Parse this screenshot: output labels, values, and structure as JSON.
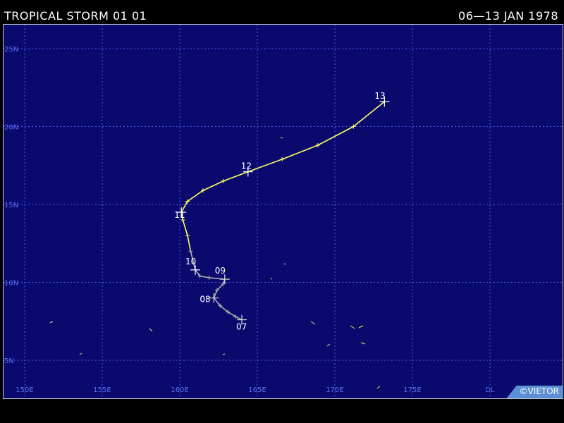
{
  "header": {
    "title": "TROPICAL STORM 01 01",
    "date_range": "06—13 JAN 1978"
  },
  "map": {
    "lat_labels": [
      "25N",
      "20N",
      "15N",
      "10N",
      "5N"
    ],
    "lon_labels": [
      "150E",
      "155E",
      "160E",
      "165E",
      "170E",
      "175E",
      "DL"
    ],
    "grid_color": "#4a5ae6",
    "background": "#0a0a6e",
    "track_color": "#ffff66",
    "early_track_color": "#b0b0b0",
    "day_labels": [
      "07",
      "08",
      "09",
      "10",
      "11",
      "12",
      "13"
    ],
    "track": [
      {
        "lon": 164.0,
        "lat": 7.6
      },
      {
        "lon": 163.6,
        "lat": 7.8
      },
      {
        "lon": 163.1,
        "lat": 8.1
      },
      {
        "lon": 162.6,
        "lat": 8.5
      },
      {
        "lon": 162.2,
        "lat": 9.0
      },
      {
        "lon": 162.4,
        "lat": 9.5
      },
      {
        "lon": 162.8,
        "lat": 9.9
      },
      {
        "lon": 162.9,
        "lat": 10.2
      },
      {
        "lon": 161.9,
        "lat": 10.3
      },
      {
        "lon": 161.3,
        "lat": 10.4
      },
      {
        "lon": 161.0,
        "lat": 10.8
      },
      {
        "lon": 160.7,
        "lat": 12.0
      },
      {
        "lon": 160.5,
        "lat": 13.0
      },
      {
        "lon": 160.2,
        "lat": 14.0
      },
      {
        "lon": 160.1,
        "lat": 14.5
      },
      {
        "lon": 160.5,
        "lat": 15.2
      },
      {
        "lon": 161.5,
        "lat": 15.9
      },
      {
        "lon": 162.8,
        "lat": 16.5
      },
      {
        "lon": 164.4,
        "lat": 17.1
      },
      {
        "lon": 166.6,
        "lat": 17.9
      },
      {
        "lon": 168.9,
        "lat": 18.8
      },
      {
        "lon": 171.2,
        "lat": 20.0
      },
      {
        "lon": 173.2,
        "lat": 21.6
      }
    ],
    "gray_segment_count": 11,
    "day_points": [
      {
        "label": "07",
        "lon": 164.0,
        "lat": 7.6
      },
      {
        "label": "08",
        "lon": 162.2,
        "lat": 9.0
      },
      {
        "label": "09",
        "lon": 162.9,
        "lat": 10.2
      },
      {
        "label": "10",
        "lon": 161.0,
        "lat": 10.8
      },
      {
        "label": "11",
        "lon": 160.1,
        "lat": 14.5
      },
      {
        "label": "12",
        "lon": 164.4,
        "lat": 17.1
      },
      {
        "label": "13",
        "lon": 173.2,
        "lat": 21.6
      }
    ]
  },
  "copyright": "©VIETOR"
}
